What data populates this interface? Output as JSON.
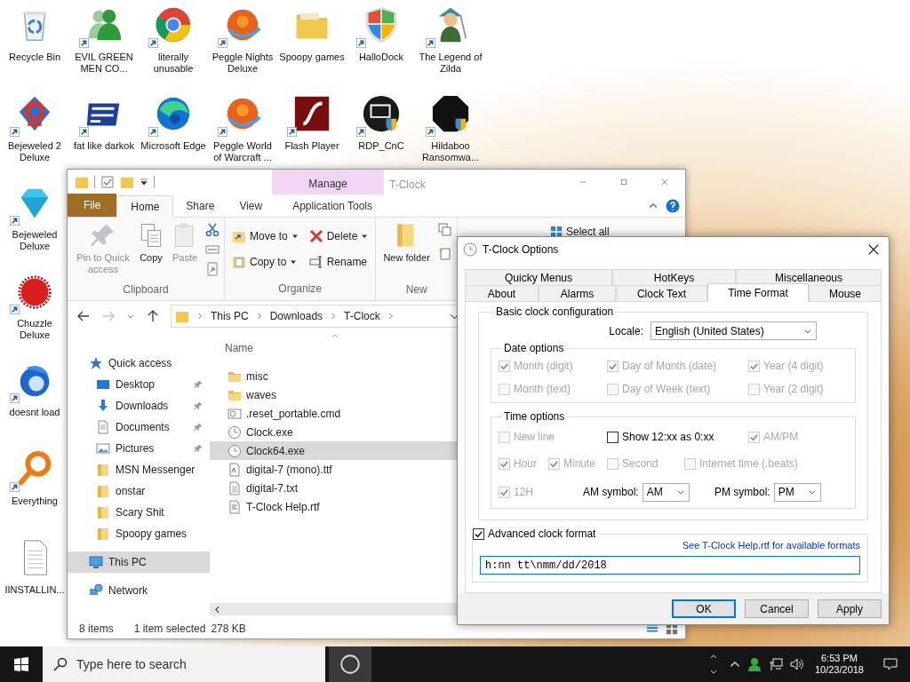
{
  "desktop": {
    "columns": [
      [
        {
          "label": "Recycle Bin",
          "kind": "bin",
          "shortcut": false
        },
        {
          "label": "Bejeweled 2 Deluxe",
          "kind": "gem",
          "shortcut": true
        },
        {
          "label": "Bejeweled Deluxe",
          "kind": "diamond",
          "shortcut": true
        },
        {
          "label": "Chuzzle Deluxe",
          "kind": "fuzzball",
          "shortcut": true
        },
        {
          "label": "doesnt load",
          "kind": "bird",
          "shortcut": true
        },
        {
          "label": "Everything",
          "kind": "magnifier",
          "shortcut": true
        },
        {
          "label": "IINSTALLIN...",
          "kind": "document",
          "shortcut": false
        }
      ],
      [
        {
          "label": "EVIL GREEN MEN CO...",
          "kind": "people",
          "shortcut": true
        },
        {
          "label": "fat like darkok",
          "kind": "emblem",
          "shortcut": true
        }
      ],
      [
        {
          "label": "literally unusable",
          "kind": "ring",
          "shortcut": true
        },
        {
          "label": "Microsoft Edge",
          "kind": "swirl",
          "shortcut": true
        }
      ],
      [
        {
          "label": "Peggle Nights Deluxe",
          "kind": "ball",
          "shortcut": true
        },
        {
          "label": "Peggle World of Warcraft ...",
          "kind": "ball",
          "shortcut": true
        }
      ],
      [
        {
          "label": "Spoopy games",
          "kind": "folder",
          "shortcut": false
        },
        {
          "label": "Flash Player",
          "kind": "tile",
          "shortcut": true
        }
      ],
      [
        {
          "label": "HalloDock",
          "kind": "shield",
          "shortcut": true
        },
        {
          "label": "RDP_CnC",
          "kind": "monitor",
          "shortcut": true
        }
      ],
      [
        {
          "label": "The Legend of Zilda",
          "kind": "figure",
          "shortcut": true
        },
        {
          "label": "Hildaboo Ransomwa...",
          "kind": "octagon",
          "shortcut": true
        }
      ]
    ]
  },
  "explorer": {
    "context_tab": "Manage",
    "title": "T-Clock",
    "ribbon_tabs": [
      {
        "label": "File",
        "kind": "file",
        "selected": false
      },
      {
        "label": "Home",
        "kind": "tab",
        "selected": true
      },
      {
        "label": "Share",
        "kind": "tab",
        "selected": false
      },
      {
        "label": "View",
        "kind": "tab",
        "selected": false
      },
      {
        "label": "Application Tools",
        "kind": "tab",
        "selected": false
      }
    ],
    "ribbon_groups": [
      {
        "label": "Clipboard",
        "items": [
          {
            "kind": "large",
            "label": "Pin to Quick access",
            "disabled": true
          },
          {
            "kind": "large",
            "label": "Copy",
            "disabled": false
          },
          {
            "kind": "large",
            "label": "Paste",
            "disabled": true
          }
        ]
      },
      {
        "label": "Organize",
        "items": [
          {
            "kind": "small",
            "label": "Move to",
            "menu": true
          },
          {
            "kind": "small",
            "label": "Delete",
            "menu": true
          },
          {
            "kind": "small",
            "label": "Copy to",
            "menu": true
          },
          {
            "kind": "small",
            "label": "Rename",
            "menu": false
          }
        ]
      },
      {
        "label": "New",
        "items": [
          {
            "kind": "large",
            "label": "New folder",
            "disabled": false
          }
        ]
      }
    ],
    "select_all": "Select all",
    "address": [
      "This PC",
      "Downloads",
      "T-Clock"
    ],
    "nav": [
      {
        "label": "Quick access",
        "selected": false,
        "children": [
          {
            "label": "Desktop",
            "pinned": true,
            "selected": false
          },
          {
            "label": "Downloads",
            "pinned": true,
            "selected": false
          },
          {
            "label": "Documents",
            "pinned": true,
            "selected": false
          },
          {
            "label": "Pictures",
            "pinned": true,
            "selected": false
          },
          {
            "label": "MSN Messenger",
            "pinned": false,
            "selected": false
          },
          {
            "label": "onstar",
            "pinned": false,
            "selected": false
          },
          {
            "label": "Scary Shit",
            "pinned": false,
            "selected": false
          },
          {
            "label": "Spoopy games",
            "pinned": false,
            "selected": false
          }
        ]
      },
      {
        "label": "This PC",
        "selected": true
      },
      {
        "label": "Network",
        "selected": false
      }
    ],
    "column": "Name",
    "files": [
      {
        "name": "misc",
        "kind": "folder",
        "selected": false
      },
      {
        "name": "waves",
        "kind": "folder",
        "selected": false
      },
      {
        "name": ".reset_portable.cmd",
        "kind": "cmd",
        "selected": false
      },
      {
        "name": "Clock.exe",
        "kind": "clock",
        "selected": false
      },
      {
        "name": "Clock64.exe",
        "kind": "clock",
        "selected": true
      },
      {
        "name": "digital-7 (mono).ttf",
        "kind": "font",
        "selected": false
      },
      {
        "name": "digital-7.txt",
        "kind": "text",
        "selected": false
      },
      {
        "name": "T-Clock Help.rtf",
        "kind": "rtf",
        "selected": false
      }
    ],
    "status": [
      "8 items",
      "1 item selected",
      "278 KB"
    ]
  },
  "dialog": {
    "title": "T-Clock Options",
    "tab_rows": [
      [
        {
          "label": "Quicky Menus",
          "selected": false
        },
        {
          "label": "HotKeys",
          "selected": false
        },
        {
          "label": "Miscellaneous",
          "selected": false
        }
      ],
      [
        {
          "label": "About",
          "selected": false
        },
        {
          "label": "Alarms",
          "selected": false
        },
        {
          "label": "Clock Text",
          "selected": false
        },
        {
          "label": "Time Format",
          "selected": true
        },
        {
          "label": "Mouse",
          "selected": false
        }
      ]
    ],
    "basic": {
      "title": "Basic clock configuration",
      "locale_label": "Locale:",
      "locale": "English (United States)"
    },
    "date": {
      "title": "Date options",
      "options": [
        {
          "label": "Month (digit)",
          "checked": true,
          "disabled": true
        },
        {
          "label": "Day of Month (date)",
          "checked": true,
          "disabled": true
        },
        {
          "label": "Year (4 digit)",
          "checked": true,
          "disabled": true
        },
        {
          "label": "Month (text)",
          "checked": false,
          "disabled": true
        },
        {
          "label": "Day of Week (text)",
          "checked": false,
          "disabled": true
        },
        {
          "label": "Year (2 digit)",
          "checked": false,
          "disabled": true
        }
      ]
    },
    "time": {
      "title": "Time options",
      "options": [
        {
          "label": "New line",
          "checked": false,
          "disabled": true
        },
        {
          "label": "Show 12:xx as 0:xx",
          "checked": false,
          "disabled": false
        },
        {
          "label": "AM/PM",
          "checked": true,
          "disabled": true
        },
        {
          "label": "Hour",
          "checked": true,
          "disabled": true
        },
        {
          "label": "Minute",
          "checked": true,
          "disabled": true
        },
        {
          "label": "Second",
          "checked": false,
          "disabled": true
        },
        {
          "label": "Internet time (.beats)",
          "checked": false,
          "disabled": true
        },
        {
          "label": "12H",
          "checked": true,
          "disabled": true
        }
      ],
      "symbols": [
        {
          "label": "AM symbol:",
          "value": "AM"
        },
        {
          "label": "PM symbol:",
          "value": "PM"
        }
      ]
    },
    "advanced": {
      "label": "Advanced clock format",
      "checked": true,
      "link": "See T-Clock Help.rtf for available formats",
      "value": "h:nn tt\\nmm/dd/2018"
    },
    "buttons": [
      {
        "label": "OK",
        "default": true
      },
      {
        "label": "Cancel",
        "default": false
      },
      {
        "label": "Apply",
        "default": false
      }
    ]
  },
  "taskbar": {
    "search_placeholder": "Type here to search",
    "time": "6:53 PM",
    "date": "10/23/2018"
  }
}
